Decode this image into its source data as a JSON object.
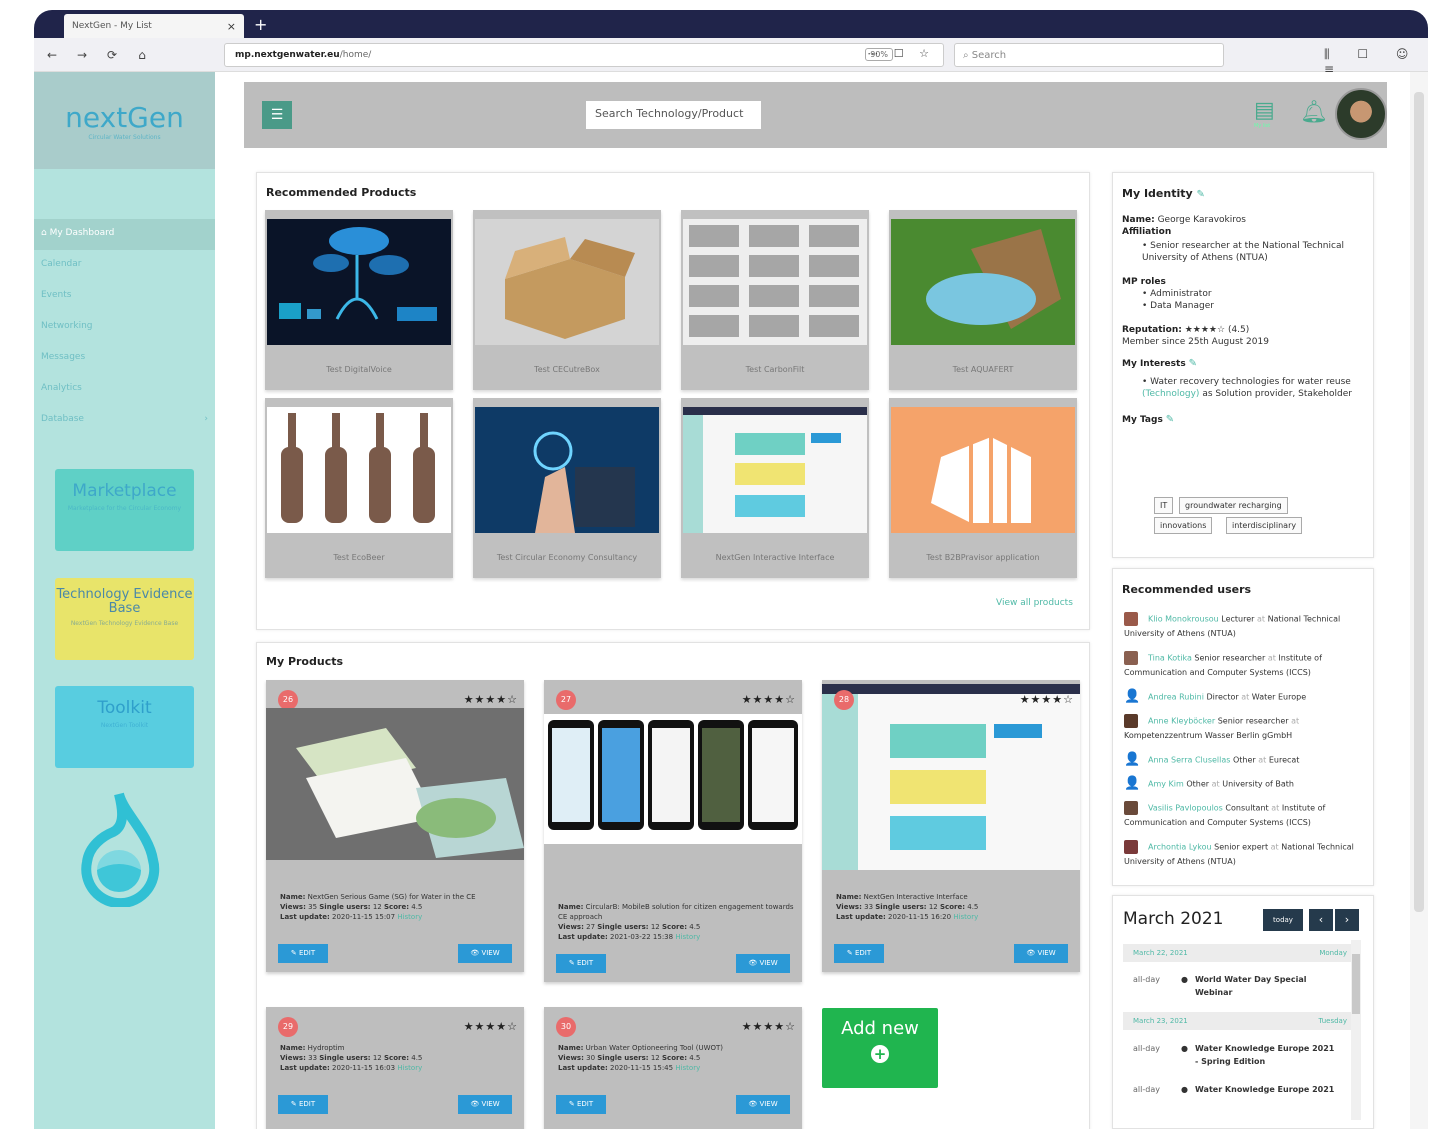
{
  "browser": {
    "tab_title": "NextGen - My List",
    "tab_close": "×",
    "new_tab": "+",
    "back": "←",
    "forward": "→",
    "reload": "⟳",
    "home": "⌂",
    "url_host": "mp.nextgenwater.eu",
    "url_path": "/home/",
    "zoom": "90%",
    "url_icons": "⋯ ☐ ☆",
    "search_placeholder": "Search",
    "right_icons": "⫼ ☐ ☺ ≡"
  },
  "sidebar": {
    "logo_name": "nextGen",
    "logo_sub": "Circular Water Solutions",
    "items": [
      {
        "label": "My Dashboard"
      },
      {
        "label": "Calendar"
      },
      {
        "label": "Events"
      },
      {
        "label": "Networking"
      },
      {
        "label": "Messages"
      },
      {
        "label": "Analytics"
      },
      {
        "label": "Database"
      }
    ],
    "database_chevron": "›",
    "promos": [
      {
        "title": "Marketplace",
        "sub": "Marketplace for the Circular Economy"
      },
      {
        "title": "Technology Evidence Base",
        "sub": "NextGen Technology Evidence Base"
      },
      {
        "title": "Toolkit",
        "sub": "NextGen Toolkit"
      }
    ]
  },
  "header": {
    "search_placeholder": "Search Technology/Product",
    "mylist_label": "My list"
  },
  "recommended": {
    "title": "Recommended Products",
    "products": [
      {
        "name": "Test DigitalVoice"
      },
      {
        "name": "Test CECutreBox"
      },
      {
        "name": "Test CarbonFilt"
      },
      {
        "name": "Test AQUAFERT"
      },
      {
        "name": "Test EcoBeer"
      },
      {
        "name": "Test Circular Economy Consultancy"
      },
      {
        "name": "NextGen Interactive Interface"
      },
      {
        "name": "Test B2BPravisor application"
      }
    ],
    "view_all": "View all products"
  },
  "my_products": {
    "title": "My Products",
    "items": [
      {
        "id": "26",
        "stars": "★★★★☆",
        "name": "NextGen Serious Game (SG) for Water in the CE",
        "views": "35",
        "single_users": "12",
        "score": "4.5",
        "updated": "2020-11-15 15:07",
        "history": "History"
      },
      {
        "id": "27",
        "stars": "★★★★☆",
        "name": "CircularB: MobileB solution for citizen engagement towards CE approach",
        "views": "27",
        "single_users": "12",
        "score": "4.5",
        "updated": "2021-03-22 15:38",
        "history": "History"
      },
      {
        "id": "28",
        "stars": "★★★★☆",
        "name": "NextGen Interactive Interface",
        "views": "33",
        "single_users": "12",
        "score": "4.5",
        "updated": "2020-11-15 16:20",
        "history": "History"
      },
      {
        "id": "29",
        "stars": "★★★★☆",
        "name": "Hydroptim",
        "views": "33",
        "single_users": "12",
        "score": "4.5",
        "updated": "2020-11-15 16:03",
        "history": "History"
      },
      {
        "id": "30",
        "stars": "★★★★☆",
        "name": "Urban Water Optioneering Tool (UWOT)",
        "views": "30",
        "single_users": "12",
        "score": "4.5",
        "updated": "2020-11-15 15:45",
        "history": "History"
      }
    ],
    "labels": {
      "name": "Name:",
      "views": "Views:",
      "single_users": "Single users:",
      "score": "Score:",
      "updated": "Last update:"
    },
    "edit_label": "✎ EDIT",
    "view_label": "👁 VIEW",
    "add_new": "Add new",
    "add_plus": "+"
  },
  "identity": {
    "title": "My Identity",
    "name_label": "Name:",
    "name": "George Karavokiros",
    "affiliation_label": "Affiliation",
    "affiliation": "Senior researcher at the National Technical University of Athens (NTUA)",
    "roles_label": "MP roles",
    "roles": [
      "Administrator",
      "Data Manager"
    ],
    "reputation_label": "Reputation:",
    "reputation_stars": "★★★★☆",
    "reputation_value": "(4.5)",
    "member_since": "Member since 25th August 2019",
    "interests_title": "My Interests",
    "interest_text": "Water recovery technologies for water reuse",
    "interest_kind": "(Technology)",
    "interest_as": "as Solution provider, Stakeholder",
    "tags_title": "My Tags",
    "tags": [
      "IT",
      "groundwater recharging",
      "innovations",
      "interdisciplinary"
    ]
  },
  "rec_users": {
    "title": "Recommended users",
    "users": [
      {
        "name": "Klio Monokrousou",
        "role": "Lecturer",
        "org": "National Technical University of Athens (NTUA)",
        "photo": true
      },
      {
        "name": "Tina Kotika",
        "role": "Senior researcher",
        "org": "Institute of Communication and Computer Systems (ICCS)",
        "photo": true
      },
      {
        "name": "Andrea Rubini",
        "role": "Director",
        "org": "Water Europe",
        "photo": false
      },
      {
        "name": "Anne Kleyböcker",
        "role": "Senior researcher",
        "org": "Kompetenzzentrum Wasser Berlin gGmbH",
        "photo": true
      },
      {
        "name": "Anna Serra Clusellas",
        "role": "Other",
        "org": "Eurecat",
        "photo": false
      },
      {
        "name": "Amy Kim",
        "role": "Other",
        "org": "University of Bath",
        "photo": false
      },
      {
        "name": "Vasilis Pavlopoulos",
        "role": "Consultant",
        "org": "Institute of Communication and Computer Systems (ICCS)",
        "photo": true
      },
      {
        "name": "Archontia Lykou",
        "role": "Senior expert",
        "org": "National Technical University of Athens (NTUA)",
        "photo": true
      }
    ],
    "at": "at",
    "person_icon": "👤"
  },
  "calendar": {
    "month": "March 2021",
    "today": "today",
    "prev": "‹",
    "next": "›",
    "days": [
      {
        "date": "March 22, 2021",
        "weekday": "Monday",
        "events": [
          {
            "allday": "all-day",
            "dot": "●",
            "name": "World Water Day Special Webinar"
          }
        ]
      },
      {
        "date": "March 23, 2021",
        "weekday": "Tuesday",
        "events": [
          {
            "allday": "all-day",
            "dot": "●",
            "name": "Water Knowledge Europe 2021 - Spring Edition"
          },
          {
            "allday": "all-day",
            "dot": "●",
            "name": "Water Knowledge Europe 2021"
          }
        ]
      }
    ]
  },
  "colors": {
    "teal": "#b3e3de",
    "accent": "#4fb9a6",
    "blue_btn": "#2b99d6",
    "green": "#20b54f",
    "badge": "#e96b6b"
  }
}
